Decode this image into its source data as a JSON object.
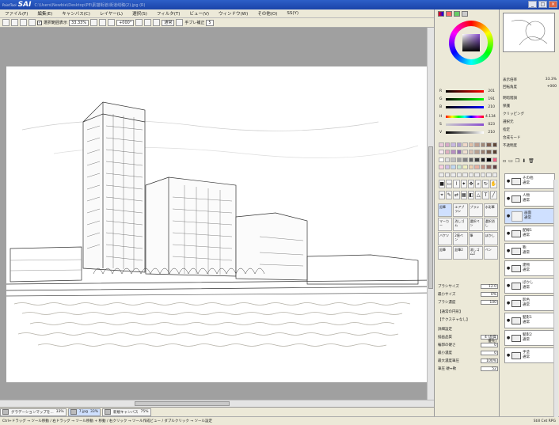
{
  "window": {
    "logo": "SAI",
    "logo_small": "PaintTool",
    "path": "C:\\Users\\Newbie\\Desktop\\PE\\素描街道\\街道线稿(2).jpg (R)"
  },
  "menu": [
    "ファイル(F)",
    "編集(E)",
    "キャンバス(C)",
    "レイヤー(L)",
    "選択(S)",
    "フィルタ(T)",
    "ビュー(V)",
    "ウィンドウ(W)",
    "その他(O)",
    "SS(Y)"
  ],
  "toolbar": {
    "check1": "選択範囲表示",
    "zoom": "33.33%",
    "angle": "+000°",
    "mode": "通常",
    "stabilizer_label": "手ブレ補正",
    "stabilizer_value": "5"
  },
  "navtabs": [
    {
      "label": "グラデーションマップを...",
      "zoom": "33%"
    },
    {
      "label": "7.jpg",
      "zoom": "33%",
      "active": true
    },
    {
      "label": "新規キャンバス",
      "zoom": "75%"
    }
  ],
  "status": {
    "left": "Ctrl+ドラッグ → ツール移動 / 右ドラッグ → ツール移動 + 移動 / 右クリック → ツール作成ビュー / ダブルクリック → ツール設定",
    "right": "Still Cet  RPG"
  },
  "colors": {
    "accent": "#2d5fc8",
    "selected": "#cfe0ff",
    "wheel_color": "#8a4fd0"
  },
  "rgb": [
    {
      "label": "R",
      "value": "201"
    },
    {
      "label": "G",
      "value": "191"
    },
    {
      "label": "B",
      "value": "210"
    }
  ],
  "hsv": [
    {
      "label": "H",
      "value": "4.134"
    },
    {
      "label": "S",
      "value": "023"
    },
    {
      "label": "V",
      "value": "210"
    }
  ],
  "brush_tools": [
    "鉛筆",
    "エアブラシ",
    "ブラシ",
    "水彩筆",
    "マーカー",
    "消しゴム",
    "選択ペン",
    "選択消し",
    "バケツ",
    "2値ペン",
    "筆",
    "ぼかし",
    "鉛筆",
    "鉛筆2",
    "消しゴム2",
    "ペン"
  ],
  "params": [
    {
      "label": "ブラシサイズ",
      "value": "12.0"
    },
    {
      "label": "最小サイズ",
      "value": "0%"
    },
    {
      "label": "ブラシ濃度",
      "value": "100"
    },
    {
      "label": "【通常の円形】",
      "value": ""
    },
    {
      "label": "【テクスチャなし】",
      "value": ""
    },
    {
      "label": "詳細設定",
      "value": ""
    },
    {
      "label": "描画品質",
      "value": "4 (品質優先)"
    },
    {
      "label": "輪郭の硬さ",
      "value": "0"
    },
    {
      "label": "最小濃度",
      "value": "0"
    },
    {
      "label": "最大濃度筆圧",
      "value": "100%"
    },
    {
      "label": "筆圧 硬↔軟",
      "value": "52"
    }
  ],
  "navigator": {
    "zoom_label": "表示倍率",
    "zoom_value": "33.3%",
    "angle_label": "回転角度",
    "angle_value": "+000"
  },
  "layer_props": [
    "明暗階調",
    "保護",
    "クリッピング",
    "選択元",
    "指定",
    "合成モード",
    "不透明度"
  ],
  "layers": [
    {
      "name": "その他",
      "mode": "通常",
      "folder": true
    },
    {
      "name": "人物",
      "mode": "通常",
      "folder": true
    },
    {
      "name": "画面",
      "mode": "通常",
      "folder": false,
      "selected": true
    },
    {
      "name": "配線1",
      "mode": "通常",
      "folder": true
    },
    {
      "name": "鞄",
      "mode": "通常",
      "folder": true
    },
    {
      "name": "建物",
      "mode": "通常",
      "folder": true
    },
    {
      "name": "ぼかし",
      "mode": "通常",
      "folder": true
    },
    {
      "name": "影色",
      "mode": "通常",
      "folder": true
    },
    {
      "name": "髪影1",
      "mode": "通常",
      "folder": true
    },
    {
      "name": "髪影2",
      "mode": "通常",
      "folder": true
    },
    {
      "name": "手塗",
      "mode": "通常",
      "folder": true
    }
  ]
}
